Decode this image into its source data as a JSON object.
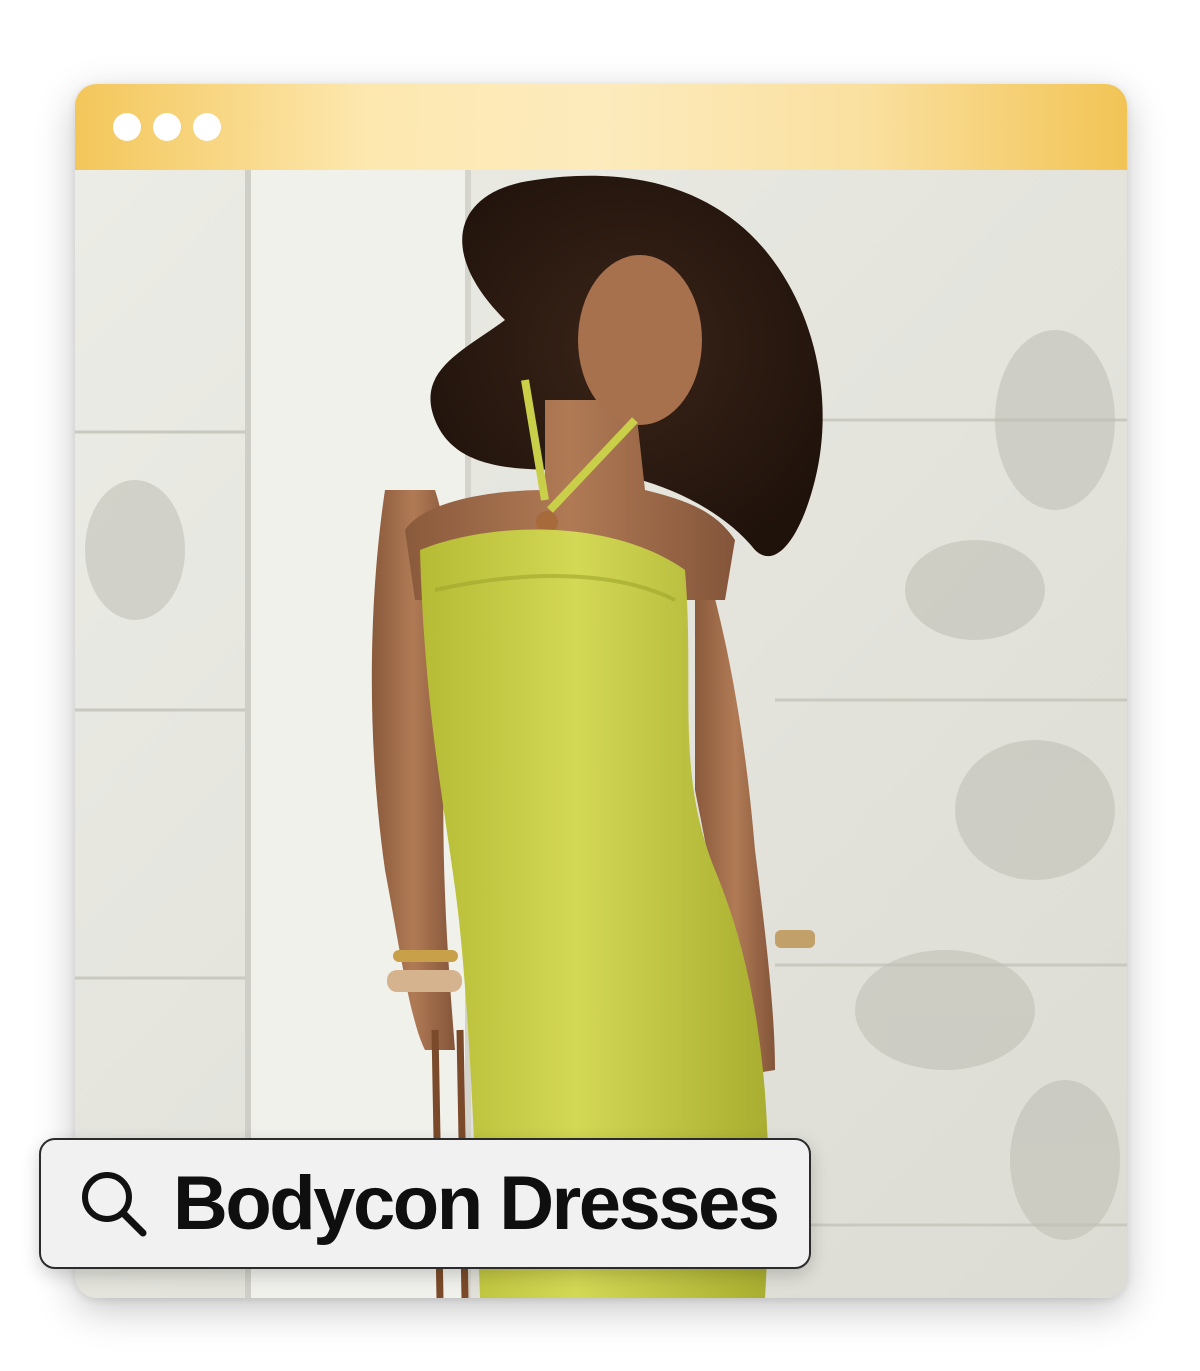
{
  "window": {
    "titlebar_colors": [
      "#f3c65a",
      "#fde8b0",
      "#f2c455"
    ],
    "control_dots": 3
  },
  "photo": {
    "subject": "dress-photo",
    "dress_color": "#c8cf4a"
  },
  "search": {
    "icon": "search-icon",
    "query": "Bodycon Dresses"
  }
}
